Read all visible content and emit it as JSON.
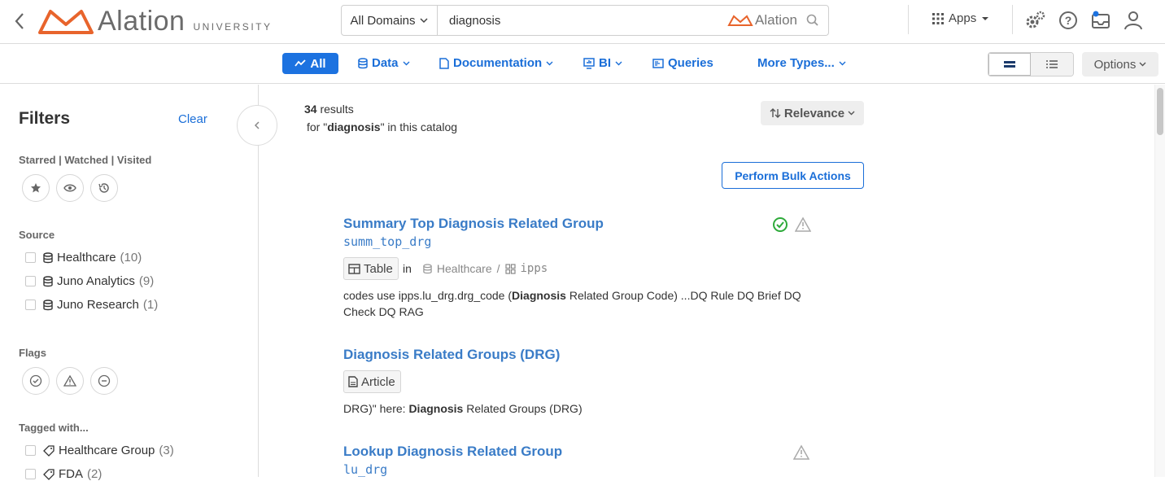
{
  "brand": {
    "word": "Alation",
    "suffix": "UNIVERSITY",
    "accent": "#e8642c"
  },
  "search": {
    "domain": "All Domains",
    "query": "diagnosis",
    "brand": "Alation"
  },
  "header": {
    "apps_label": "Apps"
  },
  "type_tabs": {
    "all": "All",
    "data": "Data",
    "documentation": "Documentation",
    "bi": "BI",
    "queries": "Queries",
    "more": "More Types..."
  },
  "options_label": "Options",
  "filters": {
    "title": "Filters",
    "clear": "Clear",
    "starred_label": "Starred | Watched | Visited",
    "source_label": "Source",
    "sources": [
      {
        "name": "Healthcare",
        "count": "(10)"
      },
      {
        "name": "Juno Analytics",
        "count": "(9)"
      },
      {
        "name": "Juno Research",
        "count": "(1)"
      }
    ],
    "flags_label": "Flags",
    "tagged_label": "Tagged with...",
    "tags": [
      {
        "name": "Healthcare Group",
        "count": "(3)"
      },
      {
        "name": "FDA",
        "count": "(2)"
      }
    ]
  },
  "results": {
    "count": "34",
    "count_suffix": " results",
    "for_prefix": " for \"",
    "query": "diagnosis",
    "for_suffix": "\" in this catalog",
    "sort": "Relevance",
    "bulk": "Perform Bulk Actions",
    "items": [
      {
        "title": "Summary Top Diagnosis Related Group",
        "subtitle": "summ_top_drg",
        "type": "Table",
        "in": "in",
        "source": "Healthcare",
        "schema": "ipps",
        "snippet_pre": "codes use ipps.lu_drg.drg_code (",
        "snippet_bold": "Diagnosis",
        "snippet_post": " Related Group Code)    ...DQ Rule DQ Brief DQ Check DQ RAG"
      },
      {
        "title": "Diagnosis Related Groups (DRG)",
        "type": "Article",
        "snippet_pre": "DRG)\" here: ",
        "snippet_bold": "Diagnosis",
        "snippet_post": " Related Groups (DRG)"
      },
      {
        "title": "Lookup Diagnosis Related Group",
        "subtitle": "lu_drg"
      }
    ]
  },
  "colors": {
    "link": "#1a6ed8",
    "title": "#3a7cc7",
    "ok": "#2eaa3a",
    "warn": "#aaaaaa"
  }
}
